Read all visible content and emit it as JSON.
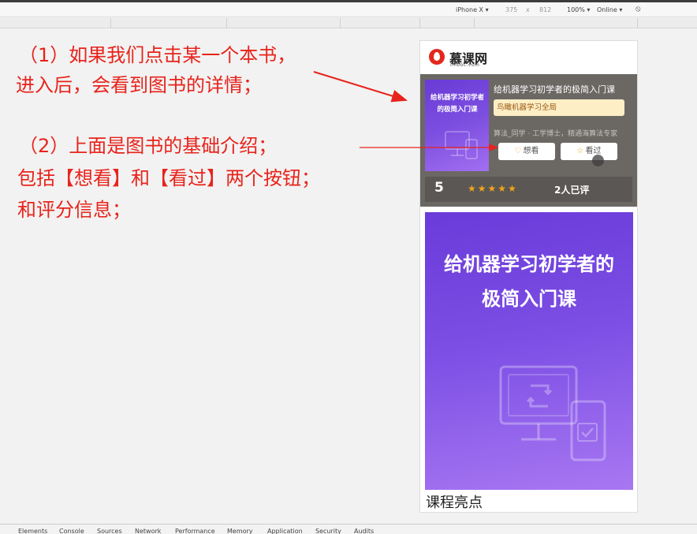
{
  "devtools_toolbar": {
    "device": "iPhone X",
    "width": "375",
    "separator": "x",
    "height": "812",
    "zoom": "100%",
    "network": "Online"
  },
  "annotations": {
    "note1_line1": "（1）如果我们点击某一个本书，",
    "note1_line2": "进入后，会看到图书的详情；",
    "note2_line1": "（2）上面是图书的基础介绍；",
    "note2_line2": "包括【想看】和【看过】两个按钮；",
    "note2_line3": "和评分信息；",
    "arrow_color": "#e8231b"
  },
  "app": {
    "logo_text": "慕课网",
    "logo_sub": "imooc.com"
  },
  "book": {
    "cover_title": "给机器学习初学者的极简入门课",
    "title": "给机器学习初学者的极简入门课",
    "tag": "鸟瞰机器学习全局",
    "author": "算法_同学 · 工学博士，精通海算法专家",
    "want_label": "想看",
    "seen_label": "看过",
    "score": "5",
    "star_count": 5,
    "rated_text": "2人已评"
  },
  "section": {
    "highlight_title": "课程亮点"
  },
  "devtools_tabs": [
    "Elements",
    "Console",
    "Sources",
    "Network",
    "Performance",
    "Memory",
    "Application",
    "Security",
    "Audits"
  ]
}
